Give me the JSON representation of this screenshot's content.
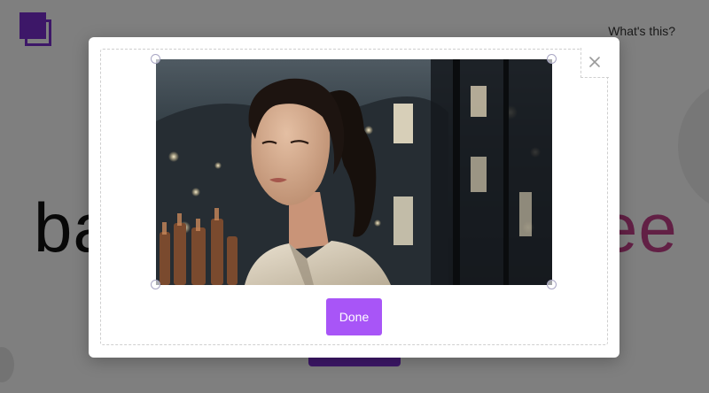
{
  "background": {
    "logo_icon": "stacked-squares-logo",
    "whats_this_link": "What's this?",
    "word_left": "ba",
    "word_right": "ee"
  },
  "modal": {
    "close_icon": "close-icon",
    "image": {
      "subject": "photo-of-woman-by-window-night-city",
      "handles": [
        "top-left",
        "top-right",
        "bottom-left",
        "bottom-right"
      ]
    },
    "done_label": "Done"
  },
  "colors": {
    "accent": "#a855f7",
    "brand": "#7b2fd1",
    "highlight_word": "#c4418a",
    "overlay": "rgba(0,0,0,0.5)"
  }
}
